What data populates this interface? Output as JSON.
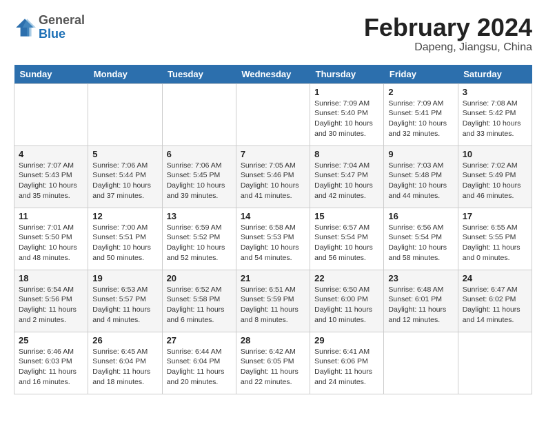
{
  "header": {
    "logo_general": "General",
    "logo_blue": "Blue",
    "month_title": "February 2024",
    "location": "Dapeng, Jiangsu, China"
  },
  "weekdays": [
    "Sunday",
    "Monday",
    "Tuesday",
    "Wednesday",
    "Thursday",
    "Friday",
    "Saturday"
  ],
  "weeks": [
    [
      {
        "day": "",
        "info": ""
      },
      {
        "day": "",
        "info": ""
      },
      {
        "day": "",
        "info": ""
      },
      {
        "day": "",
        "info": ""
      },
      {
        "day": "1",
        "info": "Sunrise: 7:09 AM\nSunset: 5:40 PM\nDaylight: 10 hours\nand 30 minutes."
      },
      {
        "day": "2",
        "info": "Sunrise: 7:09 AM\nSunset: 5:41 PM\nDaylight: 10 hours\nand 32 minutes."
      },
      {
        "day": "3",
        "info": "Sunrise: 7:08 AM\nSunset: 5:42 PM\nDaylight: 10 hours\nand 33 minutes."
      }
    ],
    [
      {
        "day": "4",
        "info": "Sunrise: 7:07 AM\nSunset: 5:43 PM\nDaylight: 10 hours\nand 35 minutes."
      },
      {
        "day": "5",
        "info": "Sunrise: 7:06 AM\nSunset: 5:44 PM\nDaylight: 10 hours\nand 37 minutes."
      },
      {
        "day": "6",
        "info": "Sunrise: 7:06 AM\nSunset: 5:45 PM\nDaylight: 10 hours\nand 39 minutes."
      },
      {
        "day": "7",
        "info": "Sunrise: 7:05 AM\nSunset: 5:46 PM\nDaylight: 10 hours\nand 41 minutes."
      },
      {
        "day": "8",
        "info": "Sunrise: 7:04 AM\nSunset: 5:47 PM\nDaylight: 10 hours\nand 42 minutes."
      },
      {
        "day": "9",
        "info": "Sunrise: 7:03 AM\nSunset: 5:48 PM\nDaylight: 10 hours\nand 44 minutes."
      },
      {
        "day": "10",
        "info": "Sunrise: 7:02 AM\nSunset: 5:49 PM\nDaylight: 10 hours\nand 46 minutes."
      }
    ],
    [
      {
        "day": "11",
        "info": "Sunrise: 7:01 AM\nSunset: 5:50 PM\nDaylight: 10 hours\nand 48 minutes."
      },
      {
        "day": "12",
        "info": "Sunrise: 7:00 AM\nSunset: 5:51 PM\nDaylight: 10 hours\nand 50 minutes."
      },
      {
        "day": "13",
        "info": "Sunrise: 6:59 AM\nSunset: 5:52 PM\nDaylight: 10 hours\nand 52 minutes."
      },
      {
        "day": "14",
        "info": "Sunrise: 6:58 AM\nSunset: 5:53 PM\nDaylight: 10 hours\nand 54 minutes."
      },
      {
        "day": "15",
        "info": "Sunrise: 6:57 AM\nSunset: 5:54 PM\nDaylight: 10 hours\nand 56 minutes."
      },
      {
        "day": "16",
        "info": "Sunrise: 6:56 AM\nSunset: 5:54 PM\nDaylight: 10 hours\nand 58 minutes."
      },
      {
        "day": "17",
        "info": "Sunrise: 6:55 AM\nSunset: 5:55 PM\nDaylight: 11 hours\nand 0 minutes."
      }
    ],
    [
      {
        "day": "18",
        "info": "Sunrise: 6:54 AM\nSunset: 5:56 PM\nDaylight: 11 hours\nand 2 minutes."
      },
      {
        "day": "19",
        "info": "Sunrise: 6:53 AM\nSunset: 5:57 PM\nDaylight: 11 hours\nand 4 minutes."
      },
      {
        "day": "20",
        "info": "Sunrise: 6:52 AM\nSunset: 5:58 PM\nDaylight: 11 hours\nand 6 minutes."
      },
      {
        "day": "21",
        "info": "Sunrise: 6:51 AM\nSunset: 5:59 PM\nDaylight: 11 hours\nand 8 minutes."
      },
      {
        "day": "22",
        "info": "Sunrise: 6:50 AM\nSunset: 6:00 PM\nDaylight: 11 hours\nand 10 minutes."
      },
      {
        "day": "23",
        "info": "Sunrise: 6:48 AM\nSunset: 6:01 PM\nDaylight: 11 hours\nand 12 minutes."
      },
      {
        "day": "24",
        "info": "Sunrise: 6:47 AM\nSunset: 6:02 PM\nDaylight: 11 hours\nand 14 minutes."
      }
    ],
    [
      {
        "day": "25",
        "info": "Sunrise: 6:46 AM\nSunset: 6:03 PM\nDaylight: 11 hours\nand 16 minutes."
      },
      {
        "day": "26",
        "info": "Sunrise: 6:45 AM\nSunset: 6:04 PM\nDaylight: 11 hours\nand 18 minutes."
      },
      {
        "day": "27",
        "info": "Sunrise: 6:44 AM\nSunset: 6:04 PM\nDaylight: 11 hours\nand 20 minutes."
      },
      {
        "day": "28",
        "info": "Sunrise: 6:42 AM\nSunset: 6:05 PM\nDaylight: 11 hours\nand 22 minutes."
      },
      {
        "day": "29",
        "info": "Sunrise: 6:41 AM\nSunset: 6:06 PM\nDaylight: 11 hours\nand 24 minutes."
      },
      {
        "day": "",
        "info": ""
      },
      {
        "day": "",
        "info": ""
      }
    ]
  ]
}
